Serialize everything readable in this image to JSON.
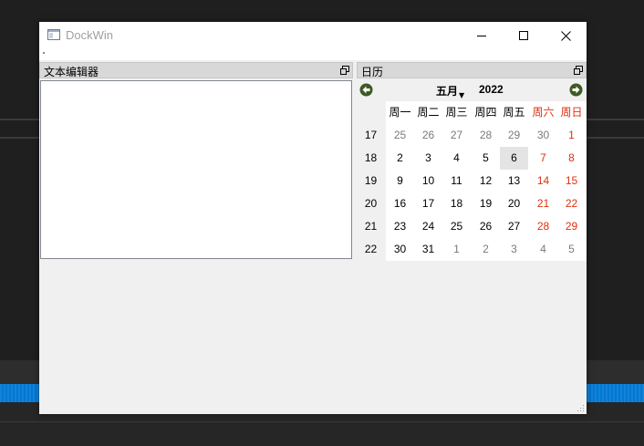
{
  "window": {
    "title": "DockWin"
  },
  "dock_editor": {
    "title": "文本编辑器",
    "content": ""
  },
  "dock_calendar": {
    "title": "日历",
    "month": "五月",
    "year": "2022",
    "weekday_headers": [
      "周一",
      "周二",
      "周三",
      "周四",
      "周五",
      "周六",
      "周日"
    ],
    "weeks": [
      {
        "week": "17",
        "days": [
          "25",
          "26",
          "27",
          "28",
          "29",
          "30",
          "1"
        ]
      },
      {
        "week": "18",
        "days": [
          "2",
          "3",
          "4",
          "5",
          "6",
          "7",
          "8"
        ]
      },
      {
        "week": "19",
        "days": [
          "9",
          "10",
          "11",
          "12",
          "13",
          "14",
          "15"
        ]
      },
      {
        "week": "20",
        "days": [
          "16",
          "17",
          "18",
          "19",
          "20",
          "21",
          "22"
        ]
      },
      {
        "week": "21",
        "days": [
          "23",
          "24",
          "25",
          "26",
          "27",
          "28",
          "29"
        ]
      },
      {
        "week": "22",
        "days": [
          "30",
          "31",
          "1",
          "2",
          "3",
          "4",
          "5"
        ]
      }
    ],
    "selected_date": "6"
  },
  "colors": {
    "weekend": "#e03010",
    "other_month": "#7a7a7a",
    "nav_arrow": "#3c5a23"
  },
  "icons": {
    "app": "window-app-icon",
    "minimize": "minimize-icon",
    "maximize": "maximize-icon",
    "close": "close-icon",
    "float": "float-restore-icon",
    "prev": "arrow-left-circle-icon",
    "next": "arrow-right-circle-icon"
  }
}
